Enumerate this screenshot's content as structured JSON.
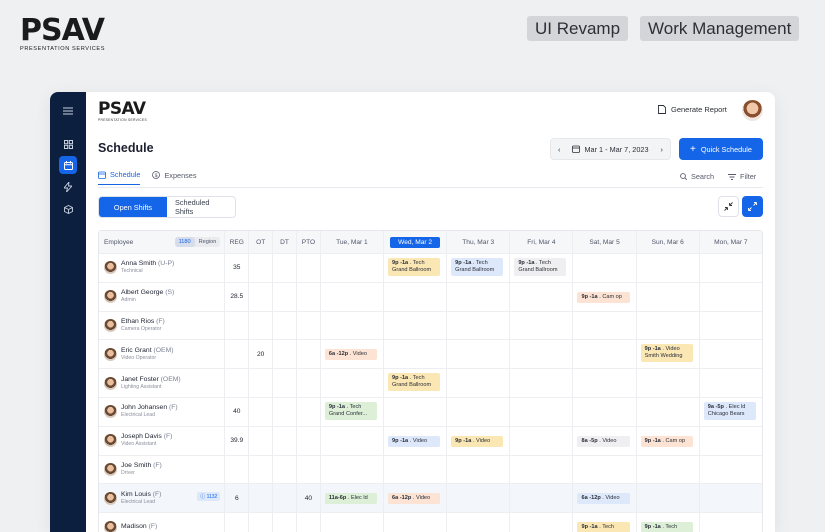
{
  "brand": {
    "word": "PSAV",
    "sub": "PRESENTATION SERVICES"
  },
  "tags": [
    "UI Revamp",
    "Work Management"
  ],
  "app": {
    "logo_word": "PSAV",
    "logo_sub": "PRESENTATION SERVICES",
    "generate_report": "Generate Report",
    "title": "Schedule",
    "date_range": "Mar 1 - Mar 7, 2023",
    "quick_schedule": "Quick Schedule",
    "tabs": [
      "Schedule",
      "Expenses"
    ],
    "search": "Search",
    "filter": "Filter",
    "segments": [
      "Open Shifts",
      "Scheduled Shifts"
    ]
  },
  "table": {
    "employee_header": "Employee",
    "toggle": [
      "1180",
      "Region"
    ],
    "cols": [
      "REG",
      "OT",
      "DT",
      "PTO"
    ],
    "days": [
      "Tue, Mar 1",
      "Wed, Mar 2",
      "Thu, Mar 3",
      "Fri, Mar 4",
      "Sat, Mar 5",
      "Sun, Mar 6",
      "Mon, Mar 7"
    ],
    "rows": [
      {
        "name": "Anna Smith",
        "code": "(U-P)",
        "role": "Technical",
        "reg": "35",
        "ot": "",
        "dt": "",
        "pto": "",
        "shifts": [
          null,
          {
            "t": "9p -1a",
            "tag": "Tech",
            "loc": "Grand Ballroom",
            "c": "yellow"
          },
          {
            "t": "9p -1a",
            "tag": "Tech",
            "loc": "Grand Ballroom",
            "c": "blue"
          },
          {
            "t": "9p -1a",
            "tag": "Tech",
            "loc": "Grand Ballroom",
            "c": "grey"
          },
          null,
          null,
          null
        ]
      },
      {
        "name": "Albert George",
        "code": "(S)",
        "role": "Admin",
        "reg": "28.5",
        "ot": "",
        "dt": "",
        "pto": "",
        "shifts": [
          null,
          null,
          null,
          null,
          {
            "t": "9p -1a",
            "tag": "Cam op",
            "loc": "",
            "c": "orange"
          },
          null,
          null
        ]
      },
      {
        "name": "Ethan Rios",
        "code": "(F)",
        "role": "Camera Operator",
        "reg": "",
        "ot": "",
        "dt": "",
        "pto": "",
        "shifts": [
          null,
          null,
          null,
          null,
          null,
          null,
          null
        ]
      },
      {
        "name": "Eric Grant",
        "code": "(OEM)",
        "role": "Video Operator",
        "reg": "",
        "ot": "20",
        "dt": "",
        "pto": "",
        "shifts": [
          {
            "t": "6a -12p",
            "tag": "Video",
            "loc": "",
            "c": "orange"
          },
          null,
          null,
          null,
          null,
          {
            "t": "9p -1a",
            "tag": "Video",
            "loc": "Smith Wedding",
            "c": "yellow"
          },
          null
        ]
      },
      {
        "name": "Janet Foster",
        "code": "(OEM)",
        "role": "Lighting Assistant",
        "reg": "",
        "ot": "",
        "dt": "",
        "pto": "",
        "shifts": [
          null,
          {
            "t": "9p -1a",
            "tag": "Tech",
            "loc": "Grand Ballroom",
            "c": "yellow"
          },
          null,
          null,
          null,
          null,
          null
        ]
      },
      {
        "name": "John Johansen",
        "code": "(F)",
        "role": "Electrical Lead",
        "reg": "40",
        "ot": "",
        "dt": "",
        "pto": "",
        "shifts": [
          {
            "t": "9p -1a",
            "tag": "Tech",
            "loc": "Grand Confer...",
            "c": "green"
          },
          null,
          null,
          null,
          null,
          null,
          {
            "t": "9a -5p",
            "tag": "Elec ld",
            "loc": "Chicago Bears",
            "c": "blue"
          }
        ]
      },
      {
        "name": "Joseph Davis",
        "code": "(F)",
        "role": "Video Assistant",
        "reg": "39.9",
        "ot": "",
        "dt": "",
        "pto": "",
        "shifts": [
          null,
          {
            "t": "9p -1a",
            "tag": "Video",
            "loc": "",
            "c": "blue"
          },
          {
            "t": "9p -1a",
            "tag": "Video",
            "loc": "",
            "c": "yellow"
          },
          null,
          {
            "t": "8a -5p",
            "tag": "Video",
            "loc": "",
            "c": "grey"
          },
          {
            "t": "9p -1a",
            "tag": "Cam op",
            "loc": "",
            "c": "orange"
          },
          null
        ]
      },
      {
        "name": "Joe Smith",
        "code": "(F)",
        "role": "Driver",
        "reg": "",
        "ot": "",
        "dt": "",
        "pto": "",
        "shifts": [
          null,
          null,
          null,
          null,
          null,
          null,
          null
        ]
      },
      {
        "name": "Kim Louis",
        "code": "(F)",
        "role": "Electrical Lead",
        "badge": "ⓘ 1132",
        "reg": "6",
        "ot": "",
        "dt": "",
        "pto": "40",
        "hl": true,
        "shifts": [
          {
            "t": "11a-6p",
            "tag": "Elec ld",
            "loc": "",
            "c": "green"
          },
          {
            "t": "6a -12p",
            "tag": "Video",
            "loc": "",
            "c": "orange"
          },
          null,
          null,
          {
            "t": "6a -12p",
            "tag": "Video",
            "loc": "",
            "c": "blue"
          },
          null,
          null
        ]
      },
      {
        "name": "Madison",
        "code": "(F)",
        "role": "",
        "reg": "",
        "ot": "",
        "dt": "",
        "pto": "",
        "shifts": [
          null,
          null,
          null,
          null,
          {
            "t": "9p -1a",
            "tag": "Tech",
            "loc": "",
            "c": "yellow"
          },
          {
            "t": "9p -1a",
            "tag": "Tech",
            "loc": "",
            "c": "green"
          },
          null
        ]
      }
    ]
  },
  "colors": {
    "primary": "#1565e8",
    "rail": "#0c1f3f"
  }
}
